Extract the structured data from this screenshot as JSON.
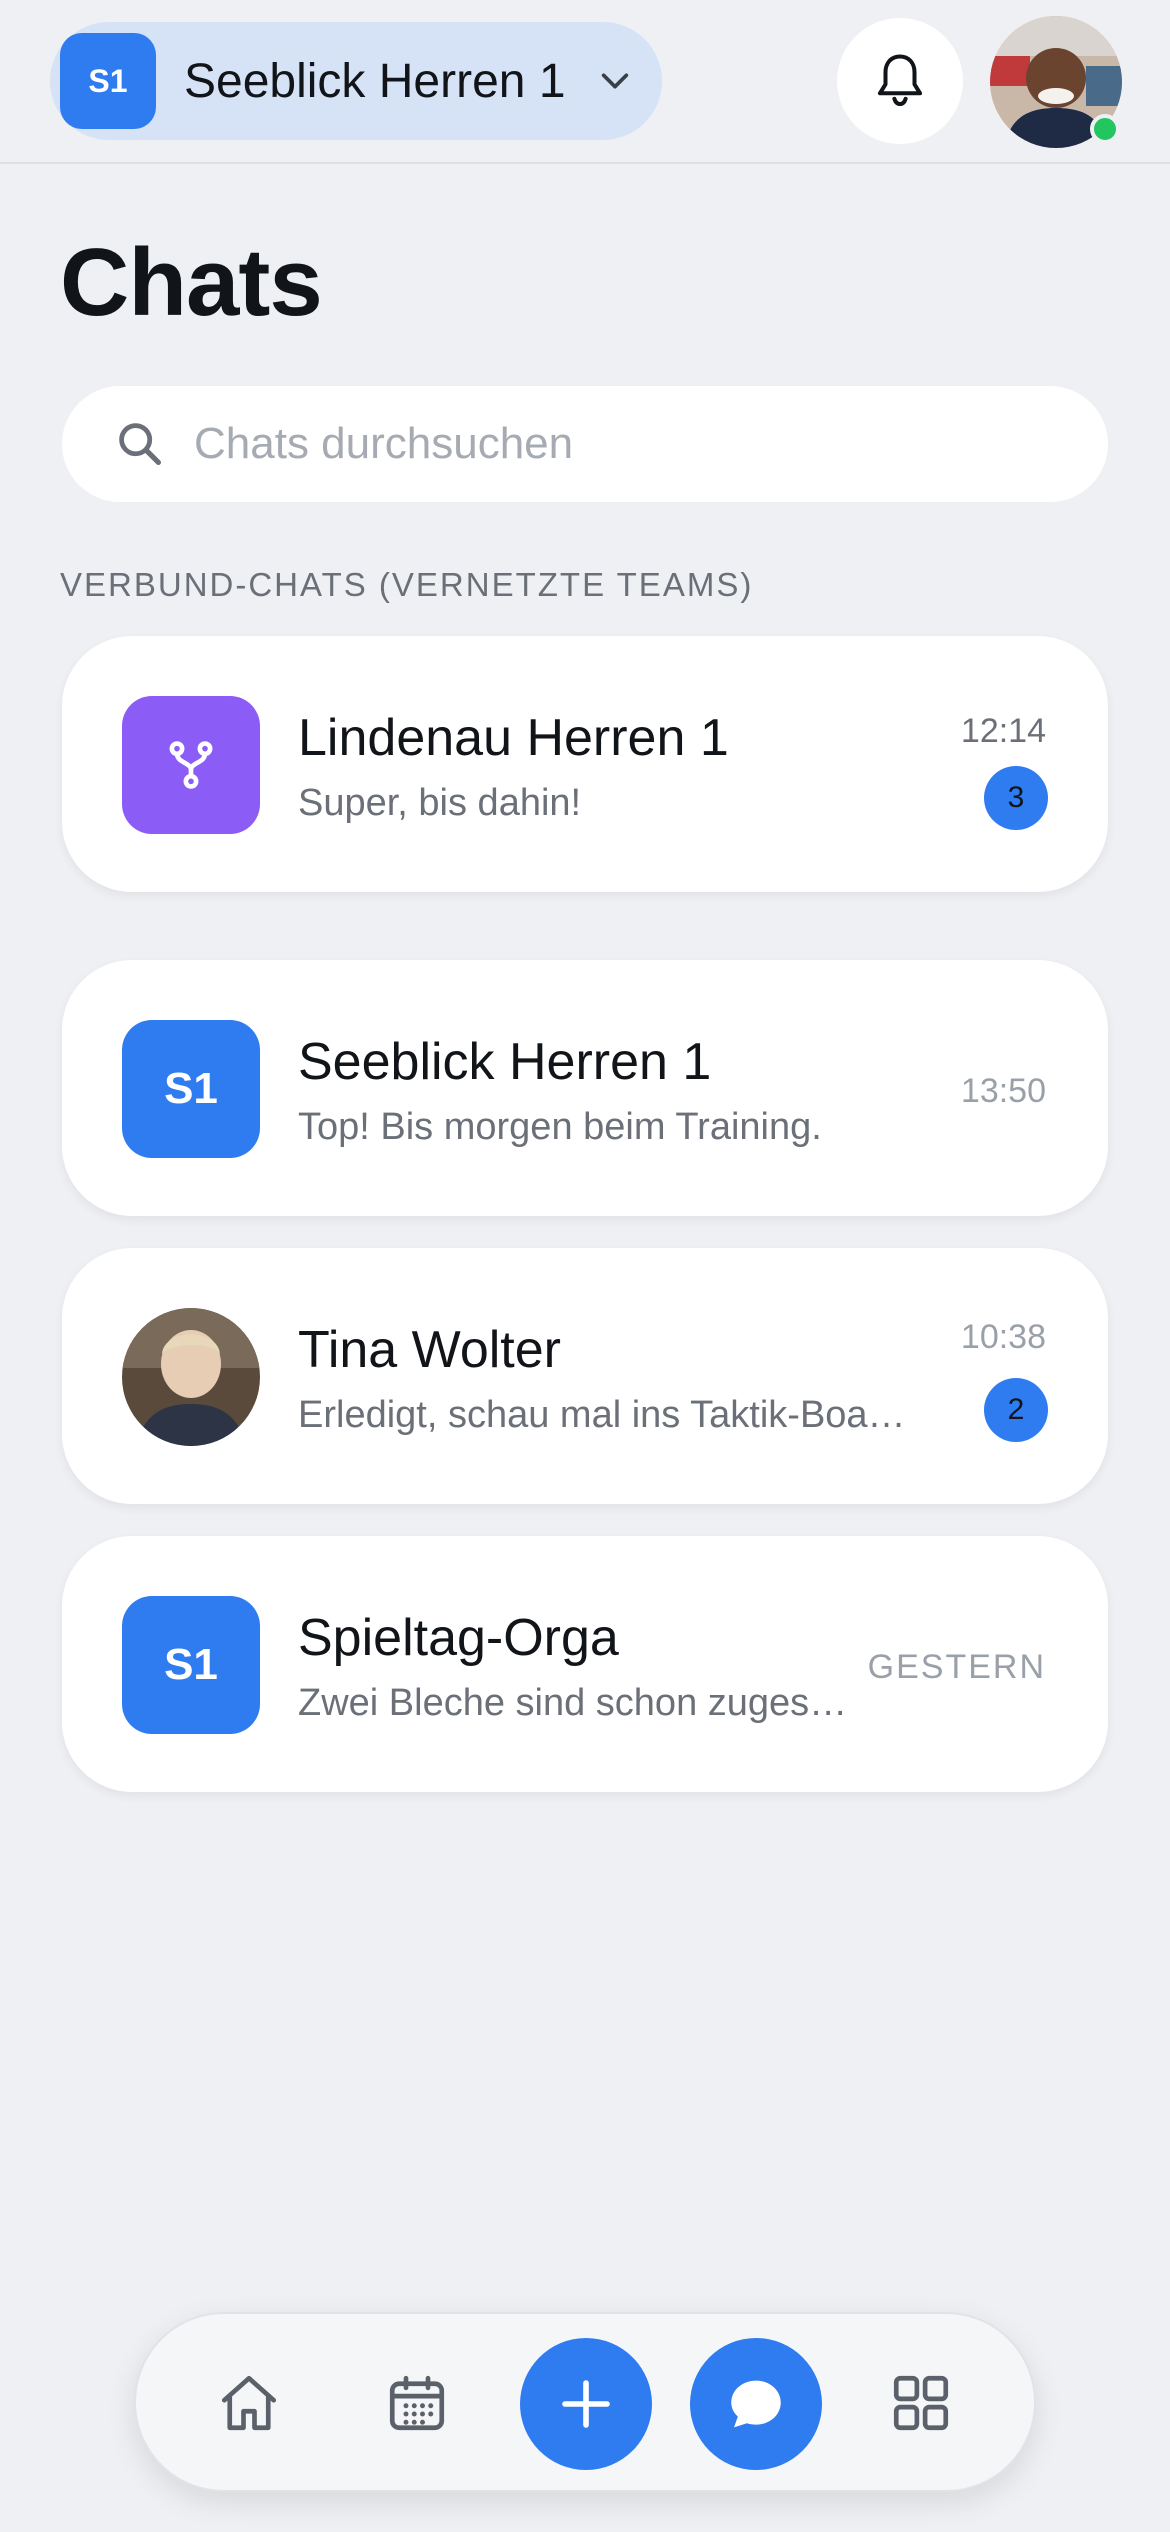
{
  "header": {
    "team_badge": "S1",
    "team_name": "Seeblick Herren 1",
    "icons": [
      "chevron-down-icon",
      "bell-icon"
    ],
    "online_status_color": "#22c55e"
  },
  "page": {
    "title": "Chats"
  },
  "search": {
    "placeholder": "Chats durchsuchen"
  },
  "section": {
    "label": "VERBUND-CHATS (VERNETZTE TEAMS)"
  },
  "chats": [
    {
      "name": "Lindenau Herren 1",
      "preview": "Super, bis dahin!",
      "time": "12:14",
      "unread": "3",
      "icon": "network-fork-icon",
      "thumb_color": "#8b5cf6"
    },
    {
      "name": "Seeblick Herren 1",
      "preview": "Top! Bis morgen beim Training.",
      "time": "13:50",
      "badge_text": "S1",
      "thumb_color": "#2f7cf0"
    },
    {
      "name": "Tina Wolter",
      "preview": "Erledigt, schau mal ins Taktik-Boa…",
      "time": "10:38",
      "unread": "2",
      "thumb": "person-avatar"
    },
    {
      "name": "Spieltag-Orga",
      "preview": "Zwei Bleche sind schon zuges…",
      "time": "GESTERN",
      "badge_text": "S1",
      "thumb_color": "#2f7cf0"
    }
  ],
  "nav": {
    "items": [
      "home-icon",
      "calendar-icon",
      "plus-icon",
      "chat-bubble-icon",
      "grid-icon"
    ],
    "accent": "#2f7cf0"
  }
}
